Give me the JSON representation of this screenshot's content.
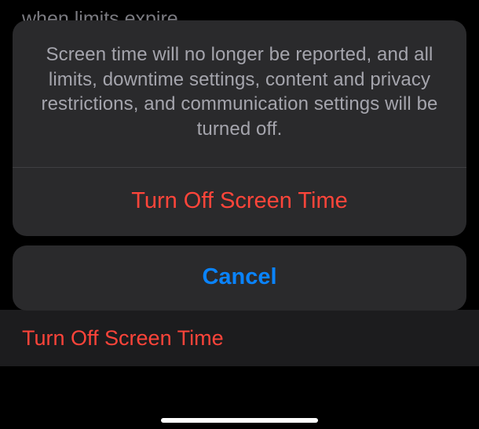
{
  "background": {
    "caption_fragment": "when limits expire.",
    "turn_off_row": "Turn Off Screen Time"
  },
  "action_sheet": {
    "message": "Screen time will no longer be reported, and all limits, downtime settings, content and privacy restrictions, and communication settings will be turned off.",
    "destructive_action": "Turn Off Screen Time",
    "cancel": "Cancel"
  }
}
